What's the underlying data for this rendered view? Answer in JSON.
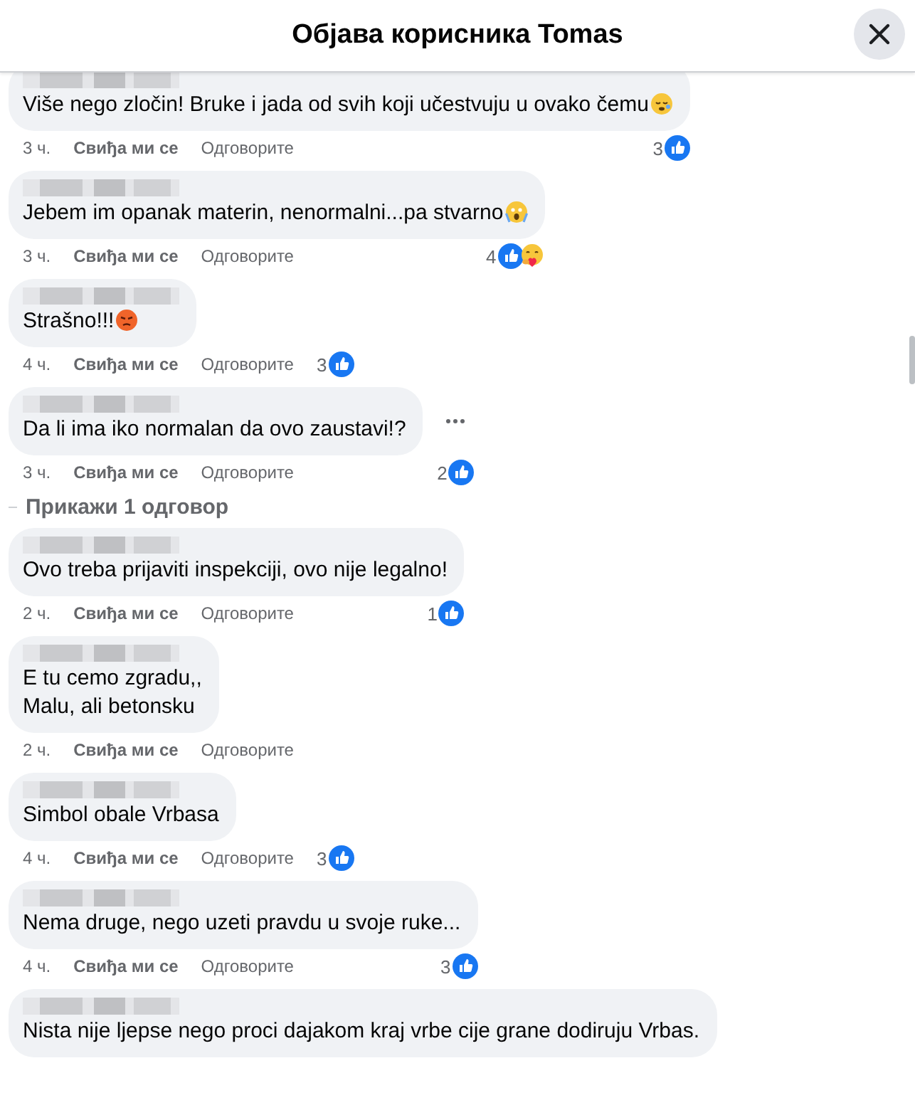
{
  "header": {
    "title": "Објава корисника Tomas"
  },
  "comments": [
    {
      "text": "Više nego zločin! Bruke i jada od svih koji učestvuju u ovako čemu",
      "emoji": {
        "kind": "sleepy"
      },
      "time": "3 ч.",
      "like": "Свиђа ми се",
      "reply": "Одговорите",
      "count": "3",
      "reactions": [
        {
          "kind": "like"
        }
      ],
      "menu": false
    },
    {
      "text": "Jebem im opanak materin, nenormalni...pa stvarno",
      "emoji": {
        "kind": "scream"
      },
      "time": "3 ч.",
      "like": "Свиђа ми се",
      "reply": "Одговорите",
      "count": "4",
      "reactions": [
        {
          "kind": "like"
        },
        {
          "kind": "care"
        }
      ],
      "menu": false
    },
    {
      "text": "Strašno!!!",
      "emoji": {
        "kind": "angry"
      },
      "time": "4 ч.",
      "like": "Свиђа ми се",
      "reply": "Одговорите",
      "count": "3",
      "reactions": [
        {
          "kind": "like"
        }
      ],
      "menu": false
    },
    {
      "text": "Da li ima iko normalan da ovo zaustavi!?",
      "time": "3 ч.",
      "like": "Свиђа ми се",
      "reply": "Одговорите",
      "count": "2",
      "reactions": [
        {
          "kind": "like"
        }
      ],
      "menu": true,
      "replies_link": "Прикажи 1 одговор"
    },
    {
      "text": "Ovo treba prijaviti inspekciji, ovo nije legalno!",
      "time": "2 ч.",
      "like": "Свиђа ми се",
      "reply": "Одговорите",
      "count": "1",
      "reactions": [
        {
          "kind": "like"
        }
      ],
      "menu": false
    },
    {
      "text": "E tu cemo zgradu,,\nMalu, ali betonsku",
      "time": "2 ч.",
      "like": "Свиђа ми се",
      "reply": "Одговорите",
      "menu": false
    },
    {
      "text": "Simbol obale Vrbasa",
      "time": "4 ч.",
      "like": "Свиђа ми се",
      "reply": "Одговорите",
      "count": "3",
      "reactions": [
        {
          "kind": "like"
        }
      ],
      "menu": false
    },
    {
      "text": "Nema druge, nego uzeti pravdu u svoje ruke...",
      "time": "4 ч.",
      "like": "Свиђа ми се",
      "reply": "Одговорите",
      "count": "3",
      "reactions": [
        {
          "kind": "like"
        }
      ],
      "menu": false
    },
    {
      "text": "Nista nije ljepse nego proci dajakom kraj vrbe cije grane dodiruju Vrbas.",
      "menu": false
    }
  ]
}
